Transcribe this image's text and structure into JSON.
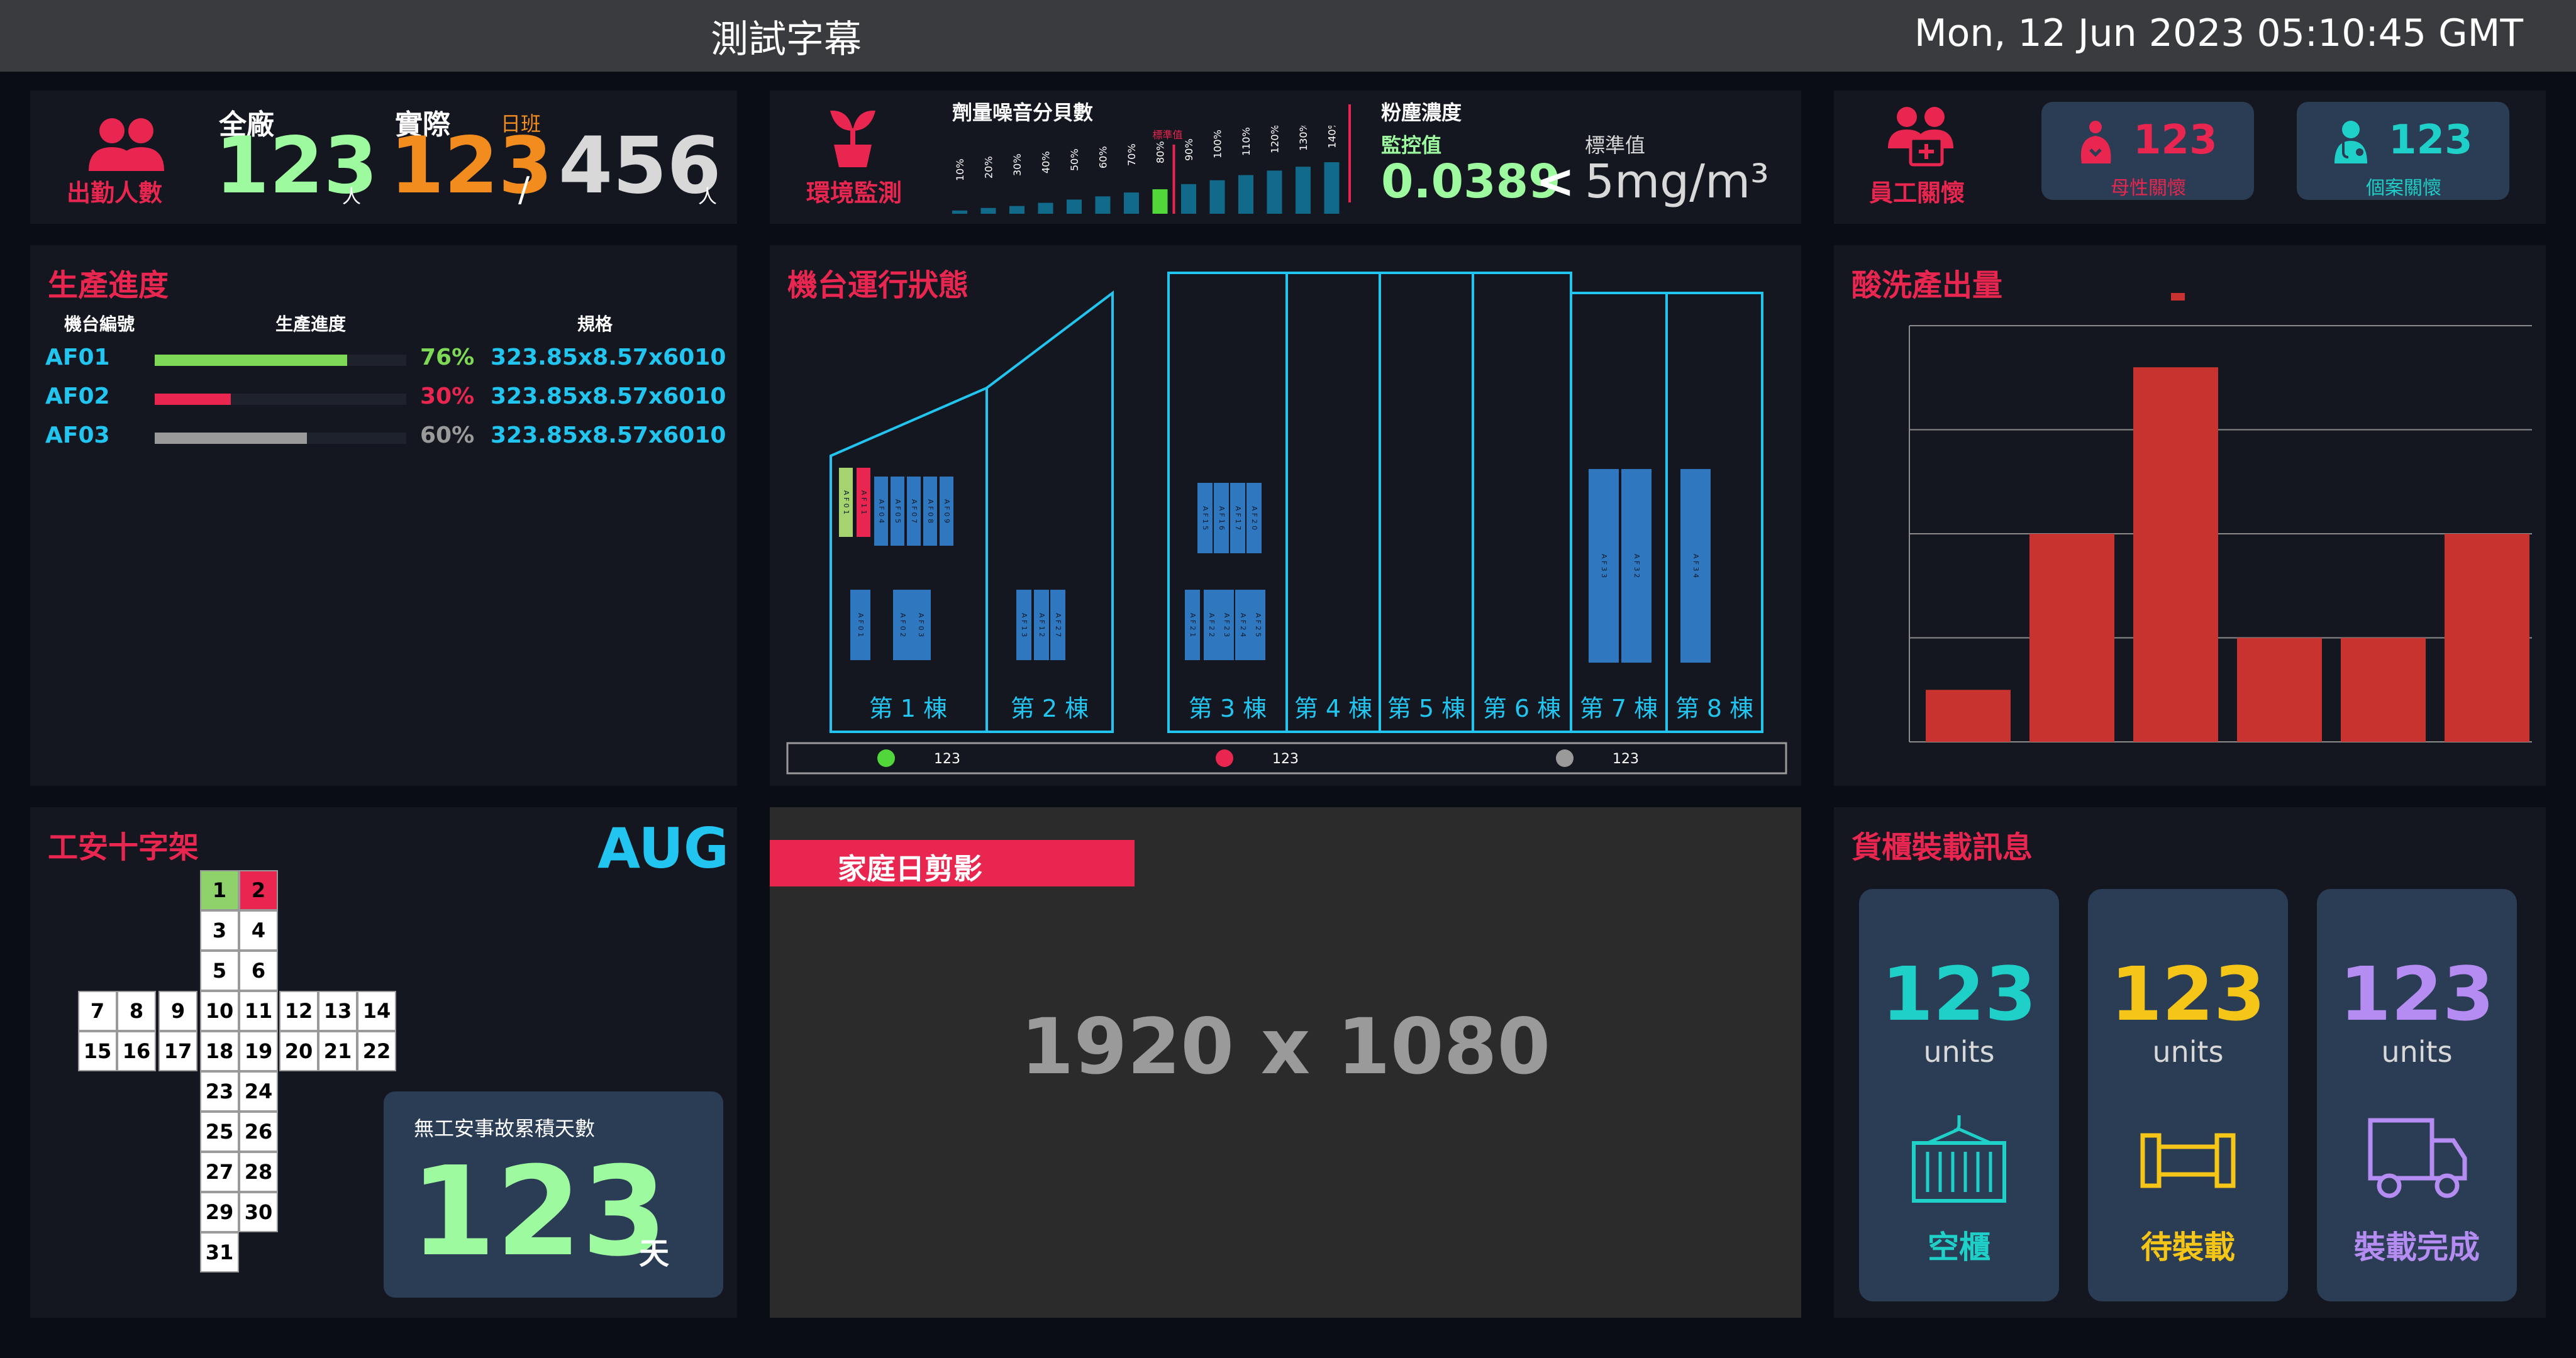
{
  "header": {
    "ticker": "測試字幕",
    "datetime": "Mon, 12 Jun 2023 05:10:45 GMT"
  },
  "attendance": {
    "label": "出勤人數",
    "total_label": "全廠",
    "total": "123",
    "unit": "人",
    "actual_label": "實際",
    "shift": "日班",
    "actual": "123",
    "slash": "/",
    "planned": "456"
  },
  "environment": {
    "label": "環境監測",
    "noise": {
      "title": "劑量噪音分貝數",
      "std_label": "標準值",
      "ticks": [
        "10%",
        "20%",
        "30%",
        "40%",
        "50%",
        "60%",
        "70%",
        "80%",
        "90%",
        "100%",
        "110%",
        "120%",
        "130%",
        "140%"
      ],
      "levels": [
        0.05,
        0.09,
        0.12,
        0.17,
        0.22,
        0.27,
        0.33,
        0.38,
        0.46,
        0.52,
        0.6,
        0.67,
        0.73,
        0.8
      ]
    },
    "dust": {
      "title": "粉塵濃度",
      "monitor_label": "監控值",
      "standard_label": "標準值",
      "monitor_value": "0.0389",
      "compare": "<",
      "standard_value": "5mg/m³"
    }
  },
  "care": {
    "label": "員工關懷",
    "maternal": {
      "value": "123",
      "label": "母性關懷"
    },
    "case": {
      "value": "123",
      "label": "個案關懷"
    }
  },
  "production": {
    "title": "生產進度",
    "headers": [
      "機台編號",
      "生產進度",
      "規格"
    ],
    "rows": [
      {
        "id": "AF01",
        "pct": "76%",
        "progress": 0.76,
        "color": "#7ed957",
        "spec": "323.85x8.57x6010"
      },
      {
        "id": "AF02",
        "pct": "30%",
        "progress": 0.3,
        "color": "#e8264f",
        "spec": "323.85x8.57x6010"
      },
      {
        "id": "AF03",
        "pct": "60%",
        "progress": 0.6,
        "color": "#9a9a9a",
        "spec": "323.85x8.57x6010"
      }
    ]
  },
  "machines": {
    "title": "機台運行狀態",
    "buildings": [
      "第 1 棟",
      "第 2 棟",
      "第 3 棟",
      "第 4 棟",
      "第 5 棟",
      "第 6 棟",
      "第 7 棟",
      "第 8 棟"
    ],
    "machines": [
      {
        "label": "AF01",
        "state": "green"
      },
      {
        "label": "AF11",
        "state": "red"
      },
      {
        "label": "AF04",
        "state": "blue"
      },
      {
        "label": "AF05",
        "state": "blue"
      },
      {
        "label": "AF07",
        "state": "blue"
      },
      {
        "label": "AF08",
        "state": "blue"
      },
      {
        "label": "AF09",
        "state": "blue"
      },
      {
        "label": "AF01",
        "state": "blue"
      },
      {
        "label": "AF02",
        "state": "blue"
      },
      {
        "label": "AF03",
        "state": "blue"
      },
      {
        "label": "AF13",
        "state": "blue"
      },
      {
        "label": "AF12",
        "state": "blue"
      },
      {
        "label": "AF27",
        "state": "blue"
      },
      {
        "label": "AF15",
        "state": "blue"
      },
      {
        "label": "AF16",
        "state": "blue"
      },
      {
        "label": "AF17",
        "state": "blue"
      },
      {
        "label": "AF20",
        "state": "blue"
      },
      {
        "label": "AF21",
        "state": "blue"
      },
      {
        "label": "AF22",
        "state": "blue"
      },
      {
        "label": "AF23",
        "state": "blue"
      },
      {
        "label": "AF24",
        "state": "blue"
      },
      {
        "label": "AF25",
        "state": "blue"
      },
      {
        "label": "AF33",
        "state": "blue"
      },
      {
        "label": "AF32",
        "state": "blue"
      },
      {
        "label": "AF34",
        "state": "blue"
      }
    ],
    "legend": [
      {
        "color": "#52d73a",
        "value": "123"
      },
      {
        "color": "#e8264f",
        "value": "123"
      },
      {
        "color": "#9a9a9a",
        "value": "123"
      }
    ]
  },
  "pickling": {
    "title": "酸洗產出量",
    "chart_data": {
      "type": "bar",
      "categories": [
        "",
        "",
        "",
        "",
        "",
        ""
      ],
      "values": [
        5,
        20,
        36,
        10,
        10,
        20
      ],
      "ylim": [
        0,
        40
      ],
      "yticks": [
        0,
        10,
        20,
        30,
        40
      ],
      "series": [
        {
          "values": [
            5,
            20,
            36,
            10,
            10,
            20
          ]
        }
      ],
      "grid": true,
      "legend": "top-center"
    },
    "bar_color": "#c8322f"
  },
  "safety": {
    "title": "工安十字架",
    "month": "AUG",
    "days": [
      {
        "d": "1",
        "c": "green"
      },
      {
        "d": "2",
        "c": "red"
      },
      {
        "d": "3"
      },
      {
        "d": "4"
      },
      {
        "d": "5"
      },
      {
        "d": "6"
      },
      {
        "d": "7"
      },
      {
        "d": "8"
      },
      {
        "d": "9"
      },
      {
        "d": "10"
      },
      {
        "d": "11"
      },
      {
        "d": "12"
      },
      {
        "d": "13"
      },
      {
        "d": "14"
      },
      {
        "d": "15"
      },
      {
        "d": "16"
      },
      {
        "d": "17"
      },
      {
        "d": "18"
      },
      {
        "d": "19"
      },
      {
        "d": "20"
      },
      {
        "d": "21"
      },
      {
        "d": "22"
      },
      {
        "d": "23"
      },
      {
        "d": "24"
      },
      {
        "d": "25"
      },
      {
        "d": "26"
      },
      {
        "d": "27"
      },
      {
        "d": "28"
      },
      {
        "d": "29"
      },
      {
        "d": "30"
      },
      {
        "d": "31"
      }
    ],
    "accident_free": {
      "label": "無工安事故累積天數",
      "value": "123",
      "unit": "天"
    }
  },
  "family": {
    "title": "家庭日剪影",
    "placeholder": "1920 x 1080"
  },
  "container": {
    "title": "貨櫃裝載訊息",
    "cards": [
      {
        "value": "123",
        "unit": "units",
        "label": "空櫃",
        "color": "#1fd0c8",
        "icon": "container-icon"
      },
      {
        "value": "123",
        "unit": "units",
        "label": "待裝載",
        "color": "#f5c518",
        "icon": "pipe-icon"
      },
      {
        "value": "123",
        "unit": "units",
        "label": "裝載完成",
        "color": "#b58cf2",
        "icon": "truck-icon"
      }
    ]
  },
  "colors": {
    "accent": "#e8264f",
    "cyan": "#22c5ef",
    "green": "#9dfa9f",
    "orange": "#f28c1e"
  }
}
